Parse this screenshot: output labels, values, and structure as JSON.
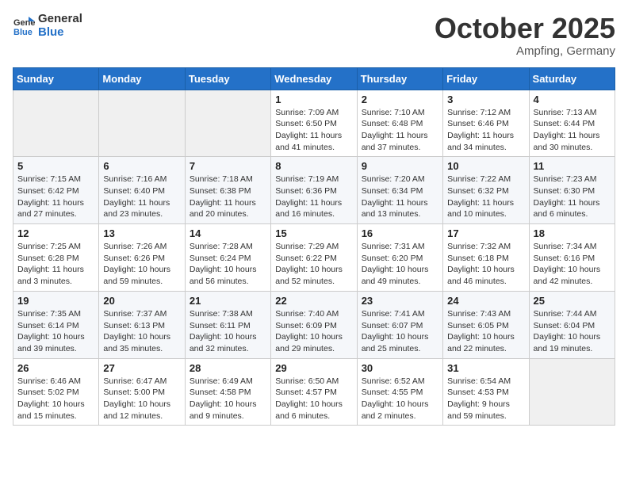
{
  "header": {
    "logo_line1": "General",
    "logo_line2": "Blue",
    "month": "October 2025",
    "location": "Ampfing, Germany"
  },
  "days_of_week": [
    "Sunday",
    "Monday",
    "Tuesday",
    "Wednesday",
    "Thursday",
    "Friday",
    "Saturday"
  ],
  "weeks": [
    [
      {
        "day": "",
        "info": ""
      },
      {
        "day": "",
        "info": ""
      },
      {
        "day": "",
        "info": ""
      },
      {
        "day": "1",
        "info": "Sunrise: 7:09 AM\nSunset: 6:50 PM\nDaylight: 11 hours and 41 minutes."
      },
      {
        "day": "2",
        "info": "Sunrise: 7:10 AM\nSunset: 6:48 PM\nDaylight: 11 hours and 37 minutes."
      },
      {
        "day": "3",
        "info": "Sunrise: 7:12 AM\nSunset: 6:46 PM\nDaylight: 11 hours and 34 minutes."
      },
      {
        "day": "4",
        "info": "Sunrise: 7:13 AM\nSunset: 6:44 PM\nDaylight: 11 hours and 30 minutes."
      }
    ],
    [
      {
        "day": "5",
        "info": "Sunrise: 7:15 AM\nSunset: 6:42 PM\nDaylight: 11 hours and 27 minutes."
      },
      {
        "day": "6",
        "info": "Sunrise: 7:16 AM\nSunset: 6:40 PM\nDaylight: 11 hours and 23 minutes."
      },
      {
        "day": "7",
        "info": "Sunrise: 7:18 AM\nSunset: 6:38 PM\nDaylight: 11 hours and 20 minutes."
      },
      {
        "day": "8",
        "info": "Sunrise: 7:19 AM\nSunset: 6:36 PM\nDaylight: 11 hours and 16 minutes."
      },
      {
        "day": "9",
        "info": "Sunrise: 7:20 AM\nSunset: 6:34 PM\nDaylight: 11 hours and 13 minutes."
      },
      {
        "day": "10",
        "info": "Sunrise: 7:22 AM\nSunset: 6:32 PM\nDaylight: 11 hours and 10 minutes."
      },
      {
        "day": "11",
        "info": "Sunrise: 7:23 AM\nSunset: 6:30 PM\nDaylight: 11 hours and 6 minutes."
      }
    ],
    [
      {
        "day": "12",
        "info": "Sunrise: 7:25 AM\nSunset: 6:28 PM\nDaylight: 11 hours and 3 minutes."
      },
      {
        "day": "13",
        "info": "Sunrise: 7:26 AM\nSunset: 6:26 PM\nDaylight: 10 hours and 59 minutes."
      },
      {
        "day": "14",
        "info": "Sunrise: 7:28 AM\nSunset: 6:24 PM\nDaylight: 10 hours and 56 minutes."
      },
      {
        "day": "15",
        "info": "Sunrise: 7:29 AM\nSunset: 6:22 PM\nDaylight: 10 hours and 52 minutes."
      },
      {
        "day": "16",
        "info": "Sunrise: 7:31 AM\nSunset: 6:20 PM\nDaylight: 10 hours and 49 minutes."
      },
      {
        "day": "17",
        "info": "Sunrise: 7:32 AM\nSunset: 6:18 PM\nDaylight: 10 hours and 46 minutes."
      },
      {
        "day": "18",
        "info": "Sunrise: 7:34 AM\nSunset: 6:16 PM\nDaylight: 10 hours and 42 minutes."
      }
    ],
    [
      {
        "day": "19",
        "info": "Sunrise: 7:35 AM\nSunset: 6:14 PM\nDaylight: 10 hours and 39 minutes."
      },
      {
        "day": "20",
        "info": "Sunrise: 7:37 AM\nSunset: 6:13 PM\nDaylight: 10 hours and 35 minutes."
      },
      {
        "day": "21",
        "info": "Sunrise: 7:38 AM\nSunset: 6:11 PM\nDaylight: 10 hours and 32 minutes."
      },
      {
        "day": "22",
        "info": "Sunrise: 7:40 AM\nSunset: 6:09 PM\nDaylight: 10 hours and 29 minutes."
      },
      {
        "day": "23",
        "info": "Sunrise: 7:41 AM\nSunset: 6:07 PM\nDaylight: 10 hours and 25 minutes."
      },
      {
        "day": "24",
        "info": "Sunrise: 7:43 AM\nSunset: 6:05 PM\nDaylight: 10 hours and 22 minutes."
      },
      {
        "day": "25",
        "info": "Sunrise: 7:44 AM\nSunset: 6:04 PM\nDaylight: 10 hours and 19 minutes."
      }
    ],
    [
      {
        "day": "26",
        "info": "Sunrise: 6:46 AM\nSunset: 5:02 PM\nDaylight: 10 hours and 15 minutes."
      },
      {
        "day": "27",
        "info": "Sunrise: 6:47 AM\nSunset: 5:00 PM\nDaylight: 10 hours and 12 minutes."
      },
      {
        "day": "28",
        "info": "Sunrise: 6:49 AM\nSunset: 4:58 PM\nDaylight: 10 hours and 9 minutes."
      },
      {
        "day": "29",
        "info": "Sunrise: 6:50 AM\nSunset: 4:57 PM\nDaylight: 10 hours and 6 minutes."
      },
      {
        "day": "30",
        "info": "Sunrise: 6:52 AM\nSunset: 4:55 PM\nDaylight: 10 hours and 2 minutes."
      },
      {
        "day": "31",
        "info": "Sunrise: 6:54 AM\nSunset: 4:53 PM\nDaylight: 9 hours and 59 minutes."
      },
      {
        "day": "",
        "info": ""
      }
    ]
  ]
}
